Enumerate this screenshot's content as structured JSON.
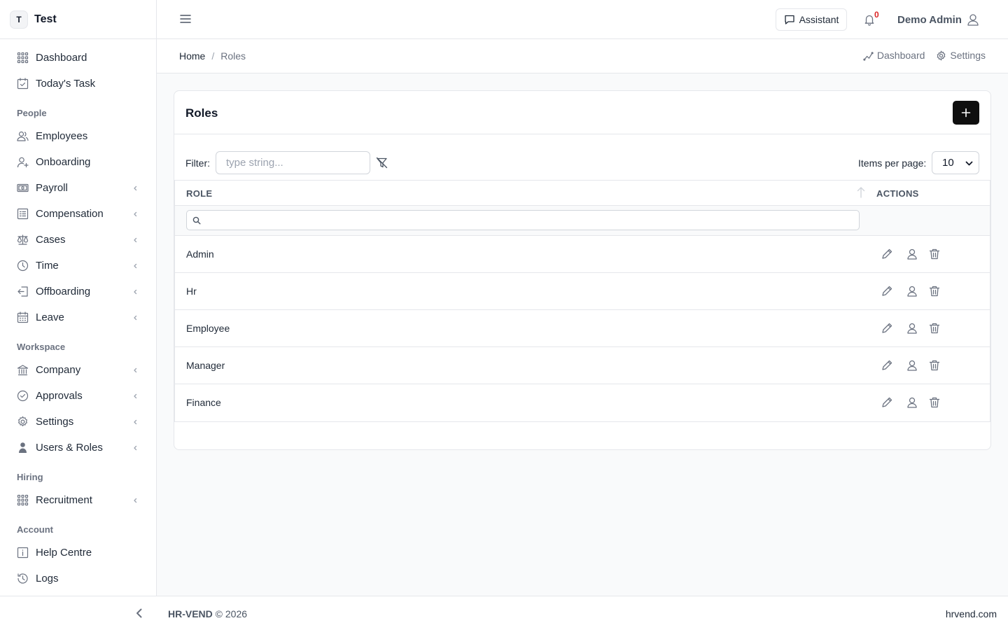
{
  "brand": {
    "initial": "T",
    "name": "Test"
  },
  "sidebar": {
    "top": [
      {
        "key": "dashboard",
        "label": "Dashboard",
        "icon": "grid-icon",
        "chevron": false
      },
      {
        "key": "todays-task",
        "label": "Today's Task",
        "icon": "calendar-check-icon",
        "chevron": false
      }
    ],
    "sections": [
      {
        "title": "People",
        "items": [
          {
            "key": "employees",
            "label": "Employees",
            "icon": "users-icon",
            "chevron": false
          },
          {
            "key": "onboarding",
            "label": "Onboarding",
            "icon": "user-add-icon",
            "chevron": false
          },
          {
            "key": "payroll",
            "label": "Payroll",
            "icon": "money-icon",
            "chevron": true
          },
          {
            "key": "compensation",
            "label": "Compensation",
            "icon": "list-icon",
            "chevron": true
          },
          {
            "key": "cases",
            "label": "Cases",
            "icon": "scale-icon",
            "chevron": true
          },
          {
            "key": "time",
            "label": "Time",
            "icon": "clock-icon",
            "chevron": true
          },
          {
            "key": "offboarding",
            "label": "Offboarding",
            "icon": "exit-icon",
            "chevron": true
          },
          {
            "key": "leave",
            "label": "Leave",
            "icon": "calendar-icon",
            "chevron": true
          }
        ]
      },
      {
        "title": "Workspace",
        "items": [
          {
            "key": "company",
            "label": "Company",
            "icon": "bank-icon",
            "chevron": true
          },
          {
            "key": "approvals",
            "label": "Approvals",
            "icon": "check-circle-icon",
            "chevron": true
          },
          {
            "key": "settings",
            "label": "Settings",
            "icon": "gear-icon",
            "chevron": true
          },
          {
            "key": "users-roles",
            "label": "Users & Roles",
            "icon": "user-shield-icon",
            "chevron": true
          }
        ]
      },
      {
        "title": "Hiring",
        "items": [
          {
            "key": "recruitment",
            "label": "Recruitment",
            "icon": "grid-icon",
            "chevron": true
          }
        ]
      },
      {
        "title": "Account",
        "items": [
          {
            "key": "help-centre",
            "label": "Help Centre",
            "icon": "info-icon",
            "chevron": false
          },
          {
            "key": "logs",
            "label": "Logs",
            "icon": "history-icon",
            "chevron": false
          }
        ]
      }
    ]
  },
  "header": {
    "assistant_label": "Assistant",
    "notification_count": "0",
    "user_name": "Demo Admin"
  },
  "breadcrumb": {
    "home": "Home",
    "separator": "/",
    "current": "Roles",
    "links": {
      "dashboard": "Dashboard",
      "settings": "Settings"
    }
  },
  "card": {
    "title": "Roles",
    "filter_label": "Filter:",
    "filter_placeholder": "type string...",
    "filter_value": "",
    "items_per_page_label": "Items per page:",
    "items_per_page_value": "10",
    "columns": {
      "role": "ROLE",
      "actions": "ACTIONS"
    },
    "column_search_value": "",
    "rows": [
      "Admin",
      "Hr",
      "Employee",
      "Manager",
      "Finance"
    ]
  },
  "footer": {
    "brand": "HR-VEND",
    "copyright": "© 2026",
    "site": "hrvend.com"
  }
}
